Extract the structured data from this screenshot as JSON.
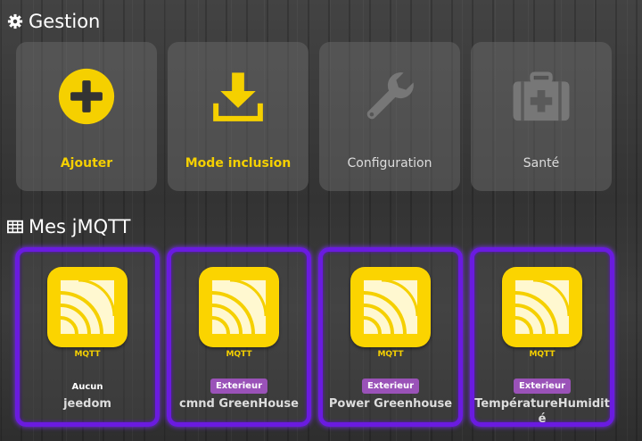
{
  "gestion": {
    "title": "Gestion",
    "tiles": [
      {
        "label": "Ajouter",
        "icon": "plus-circle-icon"
      },
      {
        "label": "Mode inclusion",
        "icon": "download-icon"
      },
      {
        "label": "Configuration",
        "icon": "wrench-icon"
      },
      {
        "label": "Santé",
        "icon": "medkit-icon"
      }
    ]
  },
  "equipements": {
    "title": "Mes jMQTT",
    "cards": [
      {
        "type": "MQTT",
        "object": "Aucun",
        "name": "jeedom"
      },
      {
        "type": "MQTT",
        "object": "Exterieur",
        "name": "cmnd GreenHouse"
      },
      {
        "type": "MQTT",
        "object": "Exterieur",
        "name": "Power Greenhouse"
      },
      {
        "type": "MQTT",
        "object": "Exterieur",
        "name": "TempératureHumidité"
      }
    ]
  },
  "colors": {
    "accent": "#f5d000",
    "border": "#6a1be0",
    "badge": "#9a52b8"
  }
}
